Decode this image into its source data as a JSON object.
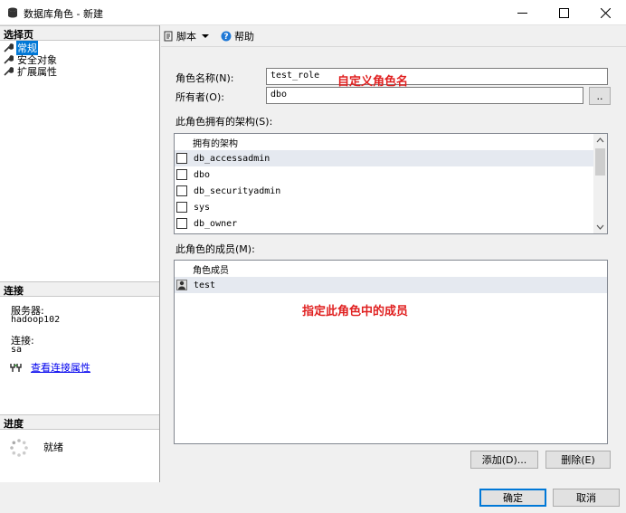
{
  "window": {
    "title": "数据库角色 - 新建",
    "controls": {
      "minimize": "—",
      "maximize": "☐",
      "close": "✕"
    }
  },
  "left_pane": {
    "select_page_header": "选择页",
    "nav_items": [
      {
        "label": "常规",
        "icon": "wrench-icon",
        "selected": true
      },
      {
        "label": "安全对象",
        "icon": "wrench-icon",
        "selected": false
      },
      {
        "label": "扩展属性",
        "icon": "wrench-icon",
        "selected": false
      }
    ],
    "connection_header": "连接",
    "server_label": "服务器:",
    "server_value": "hadoop102",
    "connection_label": "连接:",
    "connection_value": "sa",
    "view_connection_link": "查看连接属性",
    "progress_header": "进度",
    "progress_status": "就绪"
  },
  "toolbar": {
    "script_label": "脚本",
    "help_label": "帮助"
  },
  "form": {
    "role_name_label": "角色名称(N):",
    "role_name_value": "test_role",
    "owner_label": "所有者(O):",
    "owner_value": "dbo",
    "browse_button": "..",
    "annotation_role": "自定义角色名",
    "schemas_label": "此角色拥有的架构(S):",
    "schemas_header": "拥有的架构",
    "schemas": [
      {
        "name": "db_accessadmin",
        "checked": false
      },
      {
        "name": "dbo",
        "checked": false
      },
      {
        "name": "db_securityadmin",
        "checked": false
      },
      {
        "name": "sys",
        "checked": false
      },
      {
        "name": "db_owner",
        "checked": false
      }
    ],
    "members_label": "此角色的成员(M):",
    "members_header": "角色成员",
    "members": [
      {
        "name": "test",
        "icon": "user-icon"
      }
    ],
    "annotation_members": "指定此角色中的成员",
    "add_button": "添加(D)...",
    "remove_button": "删除(E)"
  },
  "footer": {
    "ok_button": "确定",
    "cancel_button": "取消"
  },
  "colors": {
    "selection": "#0078d7",
    "annotation": "#e02020",
    "link": "#0000ee"
  }
}
